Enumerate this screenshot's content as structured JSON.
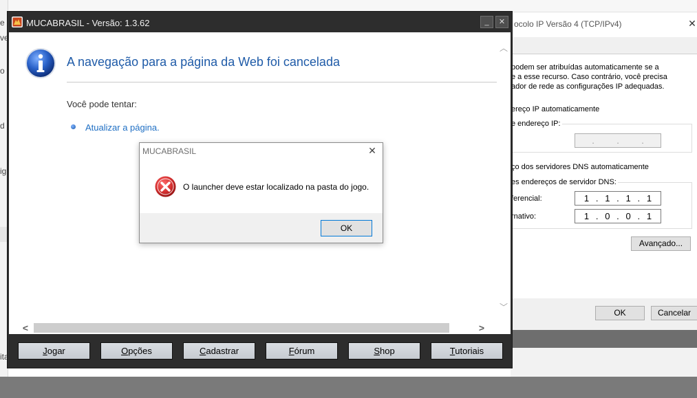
{
  "background_left": {
    "fragments": [
      "e",
      "ve",
      "o",
      "d",
      "ig",
      "ita"
    ]
  },
  "ipv4_window": {
    "title": "ocolo IP Versão 4 (TCP/IPv4)",
    "intro_lines": [
      "podem ser atribuídas automaticamente se a",
      "e a esse recurso. Caso contrário, você precisa",
      "ador de rede as configurações IP adequadas."
    ],
    "auto_ip_label": "ereço IP automaticamente",
    "manual_ip_label": "e endereço IP:",
    "auto_dns_label": "ço dos servidores DNS automaticamente",
    "manual_dns_label": "es endereços de servidor DNS:",
    "preferred_label": "ferencial:",
    "alternate_label": "rnativo:",
    "disabled_ip_octets": [
      ".",
      ".",
      "."
    ],
    "preferred_dns_octets": [
      "1",
      ".",
      "1",
      ".",
      "1",
      ".",
      "1"
    ],
    "alternate_dns_octets": [
      "1",
      ".",
      "0",
      ".",
      "0",
      ".",
      "1"
    ],
    "advanced_button": "Avançado...",
    "ok_button": "OK",
    "cancel_button": "Cancelar"
  },
  "launcher": {
    "title": "MUCABRASIL - Versão: 1.3.62",
    "minimize_glyph": "_",
    "close_glyph": "✕",
    "browser": {
      "heading": "A navegação para a página da Web foi cancelada",
      "try_label": "Você pode tentar:",
      "refresh_link": "Atualizar a página."
    },
    "scroll": {
      "up": "︿",
      "down": "﹀",
      "left": "<",
      "right": ">"
    },
    "buttons": [
      {
        "first": "J",
        "rest": "ogar"
      },
      {
        "first": "O",
        "rest": "pções"
      },
      {
        "first": "C",
        "rest": "adastrar"
      },
      {
        "first": "F",
        "rest": "órum"
      },
      {
        "first": "S",
        "rest": "hop"
      },
      {
        "first": "T",
        "rest": "utoriais"
      }
    ]
  },
  "dialog": {
    "title": "MUCABRASIL",
    "close_glyph": "✕",
    "message": "O launcher deve estar localizado na pasta do jogo.",
    "ok_button": "OK"
  },
  "colors": {
    "launcher_frame": "#2d2d2d",
    "heading_blue": "#1f5ba8",
    "link_blue": "#1f6fc4",
    "error_red": "#d32f2f"
  }
}
